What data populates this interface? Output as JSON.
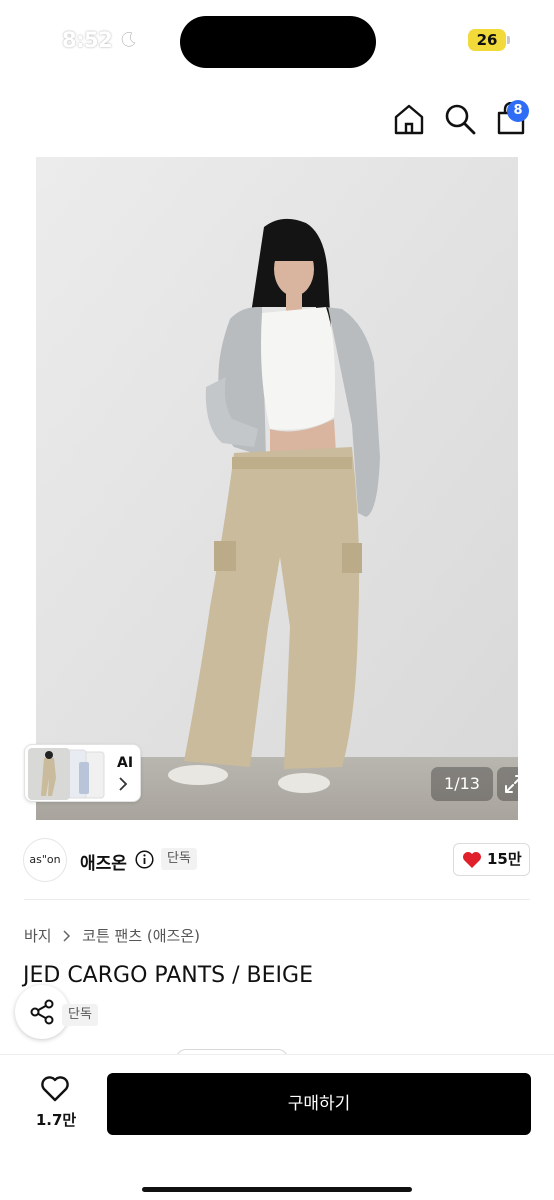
{
  "status_bar": {
    "time": "8:52",
    "battery": "26",
    "battery_color": "#f1da3a"
  },
  "header": {
    "cart_count": "8",
    "icons": [
      "close-icon",
      "home-icon",
      "search-icon",
      "cart-icon"
    ],
    "badge_color": "#2f6df6"
  },
  "gallery": {
    "page_indicator": "1/13",
    "thumb_label": "AI"
  },
  "brand": {
    "logo_text": "as\"on",
    "name": "애즈온",
    "exclusive_label": "단독",
    "likes": "15만",
    "heart_color": "#e0202a"
  },
  "product": {
    "breadcrumb": [
      "바지",
      "코튼 팬츠 (애즈온)"
    ],
    "title": "JED CARGO PANTS / BEIGE",
    "exclusive_label": "단독"
  },
  "bottom_bar": {
    "wishlist_count": "1.7만",
    "buy_label": "구매하기"
  }
}
